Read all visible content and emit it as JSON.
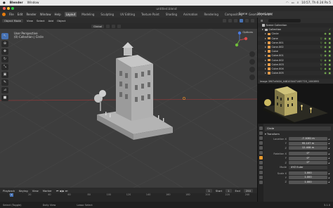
{
  "mac_menubar": {
    "apple": "",
    "app": "Blender",
    "menu": [
      "Window"
    ],
    "clock": "10:57, Th 6 24 Pa 5",
    "icons": [
      "wifi-icon",
      "battery-icon",
      "search-icon"
    ]
  },
  "window": {
    "title": "untitled.blend"
  },
  "topbar": {
    "menus": [
      "File",
      "Edit",
      "Render",
      "Window",
      "Help"
    ],
    "workspaces": [
      "Layout",
      "Modeling",
      "Sculpting",
      "UV Editing",
      "Texture Paint",
      "Shading",
      "Animation",
      "Rendering",
      "Compositing",
      "Geometry Nodes"
    ],
    "active_workspace": "Layout",
    "scene": "Scene",
    "view_layer": "View Layer"
  },
  "viewport_header": {
    "mode": "Object Mode",
    "menus": [
      "View",
      "Select",
      "Add",
      "Object"
    ],
    "orientation": "Global",
    "options": "Options"
  },
  "viewport": {
    "perspective": "User Perspective",
    "collection_info": "(0) Collection | Circle"
  },
  "outliner": {
    "title": "Scene Collection",
    "items": [
      {
        "name": "Collection",
        "indent": 0,
        "type": "collection"
      },
      {
        "name": "Circle",
        "indent": 1,
        "type": "object"
      },
      {
        "name": "Cone",
        "indent": 1,
        "type": "object"
      },
      {
        "name": "Cone.001",
        "indent": 1,
        "type": "object"
      },
      {
        "name": "Cone.002",
        "indent": 1,
        "type": "object"
      },
      {
        "name": "Cube",
        "indent": 1,
        "type": "object"
      },
      {
        "name": "Cube.001",
        "indent": 1,
        "type": "object"
      },
      {
        "name": "Cube.002",
        "indent": 1,
        "type": "object"
      },
      {
        "name": "Cube.003",
        "indent": 1,
        "type": "object"
      },
      {
        "name": "Cube.004",
        "indent": 1,
        "type": "object"
      },
      {
        "name": "Cube.005",
        "indent": 1,
        "type": "object"
      }
    ]
  },
  "image_editor": {
    "header": "Image   3907x9404_4481034471487723_1000893"
  },
  "properties": {
    "object": "Circle",
    "section": "Transform",
    "location": {
      "label": "Location X",
      "x": "-7.1081 m",
      "y_label": "Y",
      "y": "95.107 m",
      "z_label": "Z",
      "z": "12.408 m"
    },
    "rotation": {
      "label": "Rotation X",
      "x": "0°",
      "y_label": "Y",
      "y": "0°",
      "z_label": "Z",
      "z": "0°"
    },
    "mode": {
      "label": "Mode",
      "value": "XYZ Euler"
    },
    "scale": {
      "label": "Scale X",
      "x": "1.000",
      "y_label": "Y",
      "y": "1.000",
      "z_label": "Z",
      "z": "1.000"
    }
  },
  "timeline": {
    "menus": [
      "Playback",
      "Keying",
      "View",
      "Marker"
    ],
    "current_frame": "1",
    "start_label": "Start",
    "start": "1",
    "end_label": "End",
    "end": "250",
    "ticks": [
      "0",
      "20",
      "40",
      "60",
      "80",
      "100",
      "120",
      "140",
      "160",
      "180",
      "200",
      "220",
      "240"
    ]
  },
  "statusbar": {
    "items": [
      "Select (Toggle)",
      "Dolly View",
      "Lasso Select"
    ],
    "version": "3.1.0"
  },
  "colors": {
    "accent": "#4772b3",
    "blender_orange": "#e87d0d",
    "viewport_bg": "#3d3d3d"
  }
}
